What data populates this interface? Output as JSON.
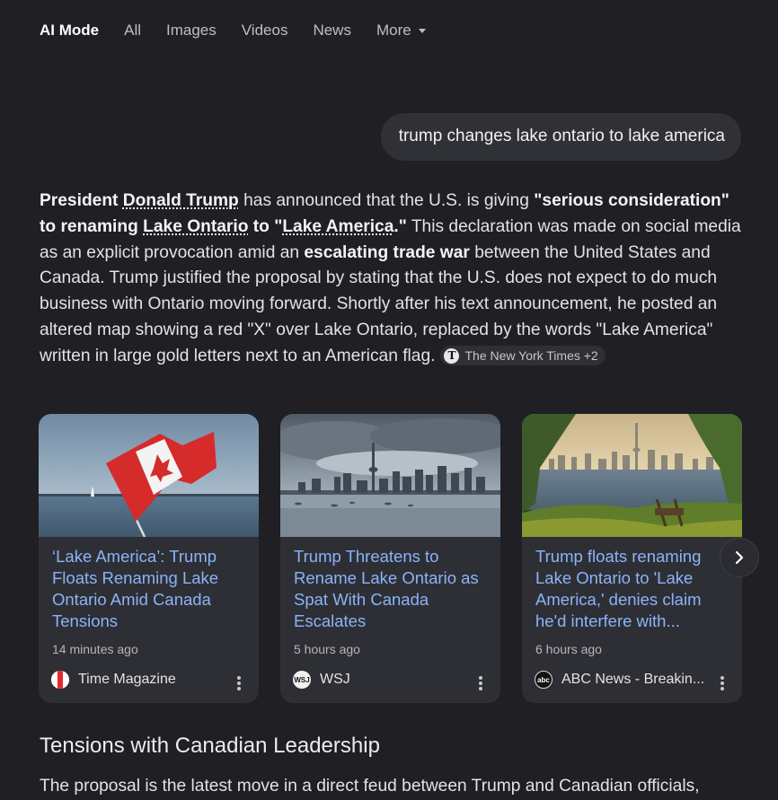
{
  "tabs": [
    {
      "label": "AI Mode",
      "active": true
    },
    {
      "label": "All"
    },
    {
      "label": "Images"
    },
    {
      "label": "Videos"
    },
    {
      "label": "News"
    },
    {
      "label": "More",
      "has_dropdown": true
    }
  ],
  "query": "trump changes lake ontario to lake america",
  "answer": {
    "t1": "President ",
    "t2": "Donald Trump",
    "t3": " has announced that the U.S. is giving ",
    "t4": "\"serious consideration\" to renaming ",
    "t5": "Lake Ontario",
    "t6": " to \"",
    "t7": "Lake America",
    "t8": ".\"",
    "t9": " This declaration was made on social media as an explicit provocation amid an ",
    "t10": "escalating trade war",
    "t11": " between the United States and Canada. Trump justified the proposal by stating that the U.S. does not expect to do much business with Ontario moving forward. Shortly after his text announcement, he posted an altered map showing a red \"X\" over Lake Ontario, replaced by the words \"Lake America\" written in large gold letters next to an American flag.",
    "source_chip": "The New York Times +2",
    "source_logo_letter": "T"
  },
  "cards": [
    {
      "title": "‘Lake America’: Trump Floats Renaming Lake Ontario Amid Canada Tensions",
      "time": "14 minutes ago",
      "source": "Time Magazine",
      "logo": ""
    },
    {
      "title": "Trump Threatens to Rename Lake Ontario as Spat With Canada Escalates",
      "time": "5 hours ago",
      "source": "WSJ",
      "logo": "WSJ"
    },
    {
      "title": "Trump floats renaming Lake Ontario to 'Lake America,' denies claim he'd interfere with...",
      "time": "6 hours ago",
      "source": "ABC News - Breakin...",
      "logo": "abc"
    }
  ],
  "next_icon": "chevron-right-icon",
  "section": {
    "heading": "Tensions with Canadian Leadership",
    "paragraph": "The proposal is the latest move in a direct feud between Trump and Canadian officials,"
  },
  "colors": {
    "background": "#1f1f24",
    "link": "#8ab4f8",
    "card": "#2e2f35"
  }
}
